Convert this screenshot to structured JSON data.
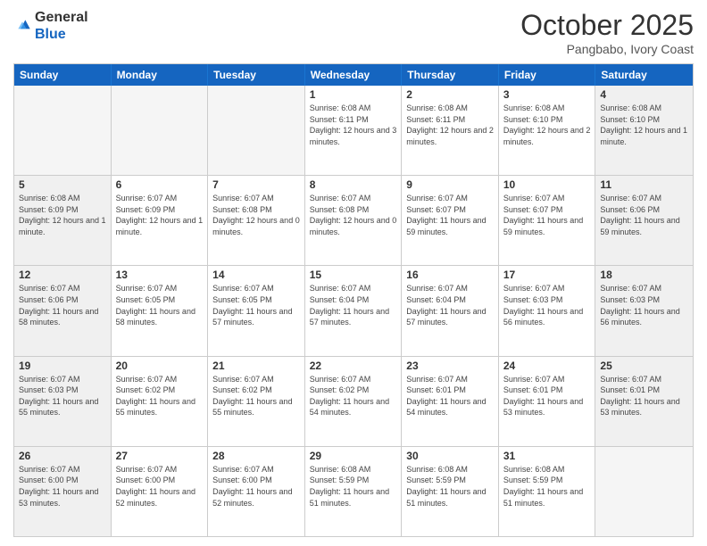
{
  "logo": {
    "general": "General",
    "blue": "Blue"
  },
  "title": "October 2025",
  "subtitle": "Pangbabo, Ivory Coast",
  "days_of_week": [
    "Sunday",
    "Monday",
    "Tuesday",
    "Wednesday",
    "Thursday",
    "Friday",
    "Saturday"
  ],
  "weeks": [
    [
      {
        "day": "",
        "empty": true
      },
      {
        "day": "",
        "empty": true
      },
      {
        "day": "",
        "empty": true
      },
      {
        "day": "1",
        "sunrise": "6:08 AM",
        "sunset": "6:11 PM",
        "daylight": "12 hours and 3 minutes."
      },
      {
        "day": "2",
        "sunrise": "6:08 AM",
        "sunset": "6:11 PM",
        "daylight": "12 hours and 2 minutes."
      },
      {
        "day": "3",
        "sunrise": "6:08 AM",
        "sunset": "6:10 PM",
        "daylight": "12 hours and 2 minutes."
      },
      {
        "day": "4",
        "sunrise": "6:08 AM",
        "sunset": "6:10 PM",
        "daylight": "12 hours and 1 minute."
      }
    ],
    [
      {
        "day": "5",
        "sunrise": "6:08 AM",
        "sunset": "6:09 PM",
        "daylight": "12 hours and 1 minute."
      },
      {
        "day": "6",
        "sunrise": "6:07 AM",
        "sunset": "6:09 PM",
        "daylight": "12 hours and 1 minute."
      },
      {
        "day": "7",
        "sunrise": "6:07 AM",
        "sunset": "6:08 PM",
        "daylight": "12 hours and 0 minutes."
      },
      {
        "day": "8",
        "sunrise": "6:07 AM",
        "sunset": "6:08 PM",
        "daylight": "12 hours and 0 minutes."
      },
      {
        "day": "9",
        "sunrise": "6:07 AM",
        "sunset": "6:07 PM",
        "daylight": "11 hours and 59 minutes."
      },
      {
        "day": "10",
        "sunrise": "6:07 AM",
        "sunset": "6:07 PM",
        "daylight": "11 hours and 59 minutes."
      },
      {
        "day": "11",
        "sunrise": "6:07 AM",
        "sunset": "6:06 PM",
        "daylight": "11 hours and 59 minutes."
      }
    ],
    [
      {
        "day": "12",
        "sunrise": "6:07 AM",
        "sunset": "6:06 PM",
        "daylight": "11 hours and 58 minutes."
      },
      {
        "day": "13",
        "sunrise": "6:07 AM",
        "sunset": "6:05 PM",
        "daylight": "11 hours and 58 minutes."
      },
      {
        "day": "14",
        "sunrise": "6:07 AM",
        "sunset": "6:05 PM",
        "daylight": "11 hours and 57 minutes."
      },
      {
        "day": "15",
        "sunrise": "6:07 AM",
        "sunset": "6:04 PM",
        "daylight": "11 hours and 57 minutes."
      },
      {
        "day": "16",
        "sunrise": "6:07 AM",
        "sunset": "6:04 PM",
        "daylight": "11 hours and 57 minutes."
      },
      {
        "day": "17",
        "sunrise": "6:07 AM",
        "sunset": "6:03 PM",
        "daylight": "11 hours and 56 minutes."
      },
      {
        "day": "18",
        "sunrise": "6:07 AM",
        "sunset": "6:03 PM",
        "daylight": "11 hours and 56 minutes."
      }
    ],
    [
      {
        "day": "19",
        "sunrise": "6:07 AM",
        "sunset": "6:03 PM",
        "daylight": "11 hours and 55 minutes."
      },
      {
        "day": "20",
        "sunrise": "6:07 AM",
        "sunset": "6:02 PM",
        "daylight": "11 hours and 55 minutes."
      },
      {
        "day": "21",
        "sunrise": "6:07 AM",
        "sunset": "6:02 PM",
        "daylight": "11 hours and 55 minutes."
      },
      {
        "day": "22",
        "sunrise": "6:07 AM",
        "sunset": "6:02 PM",
        "daylight": "11 hours and 54 minutes."
      },
      {
        "day": "23",
        "sunrise": "6:07 AM",
        "sunset": "6:01 PM",
        "daylight": "11 hours and 54 minutes."
      },
      {
        "day": "24",
        "sunrise": "6:07 AM",
        "sunset": "6:01 PM",
        "daylight": "11 hours and 53 minutes."
      },
      {
        "day": "25",
        "sunrise": "6:07 AM",
        "sunset": "6:01 PM",
        "daylight": "11 hours and 53 minutes."
      }
    ],
    [
      {
        "day": "26",
        "sunrise": "6:07 AM",
        "sunset": "6:00 PM",
        "daylight": "11 hours and 53 minutes."
      },
      {
        "day": "27",
        "sunrise": "6:07 AM",
        "sunset": "6:00 PM",
        "daylight": "11 hours and 52 minutes."
      },
      {
        "day": "28",
        "sunrise": "6:07 AM",
        "sunset": "6:00 PM",
        "daylight": "11 hours and 52 minutes."
      },
      {
        "day": "29",
        "sunrise": "6:08 AM",
        "sunset": "5:59 PM",
        "daylight": "11 hours and 51 minutes."
      },
      {
        "day": "30",
        "sunrise": "6:08 AM",
        "sunset": "5:59 PM",
        "daylight": "11 hours and 51 minutes."
      },
      {
        "day": "31",
        "sunrise": "6:08 AM",
        "sunset": "5:59 PM",
        "daylight": "11 hours and 51 minutes."
      },
      {
        "day": "",
        "empty": true
      }
    ]
  ]
}
